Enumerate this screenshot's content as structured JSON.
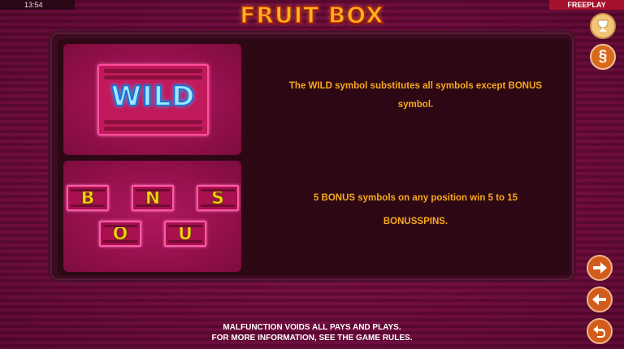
{
  "status": {
    "clock": "13:54",
    "mode": "FREEPLAY"
  },
  "title": "FRUIT BOX",
  "buttons": {
    "paytable_icon": "trophy-icon",
    "rules_icon": "section-sign-icon",
    "rules_glyph": "§",
    "next_icon": "arrow-right-icon",
    "previous_icon": "arrow-left-icon",
    "back_icon": "return-arrow-icon"
  },
  "wild": {
    "symbol_text": "WILD",
    "description": "The WILD symbol substitutes all symbols except BONUS symbol."
  },
  "bonus": {
    "letters": [
      "B",
      "N",
      "S",
      "O",
      "U"
    ],
    "description_line1": "5 BONUS symbols on any position win 5 to 15",
    "description_line2": "BONUSSPINS."
  },
  "footer": {
    "line1": "MALFUNCTION VOIDS ALL PAYS AND PLAYS.",
    "line2": "FOR MORE INFORMATION, SEE THE GAME RULES."
  },
  "colors": {
    "background": "#6d0b3a",
    "panel": "#2d0814",
    "text_accent": "#f7a91c",
    "tile_letter": "#ffd21a",
    "wild_text": "#9fe6ff",
    "button_orange": "#d25c1b"
  }
}
